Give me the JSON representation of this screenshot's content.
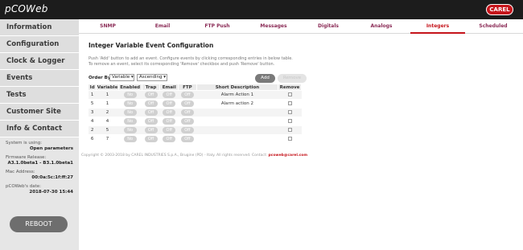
{
  "app": {
    "logo": "pCOWeb",
    "brand": "CAREL"
  },
  "sidebar": {
    "items": [
      {
        "label": "Information"
      },
      {
        "label": "Configuration"
      },
      {
        "label": "Clock & Logger"
      },
      {
        "label": "Events"
      },
      {
        "label": "Tests"
      },
      {
        "label": "Customer Site"
      },
      {
        "label": "Info & Contact"
      }
    ],
    "system_label": "System is using:",
    "system_value": "Open parameters",
    "firmware_label": "Firmware Release:",
    "firmware_value": "A3.1.0beta1 - B3.1.0beta1",
    "mac_label": "Mac Address:",
    "mac_value": "00:0a:5c:1f:ff:27",
    "date_label": "pCOWeb's date:",
    "date_value": "2018-07-30 15:44",
    "reboot_label": "REBOOT"
  },
  "tabs": [
    {
      "label": "SNMP"
    },
    {
      "label": "Email"
    },
    {
      "label": "FTP Push"
    },
    {
      "label": "Messages"
    },
    {
      "label": "Digitals"
    },
    {
      "label": "Analogs"
    },
    {
      "label": "Integers"
    },
    {
      "label": "Scheduled"
    }
  ],
  "page": {
    "title": "Integer Variable Event Configuration",
    "desc1": "Push 'Add' button to add an event. Configure events by clicking corresponding entries in below table.",
    "desc2": "To remove an event, select its corresponding 'Remove' checkbox and push 'Remove' button.",
    "order_label": "Order By",
    "order_by": "Variable",
    "order_dir": "Ascending",
    "add_label": "Add",
    "remove_label": "Remove"
  },
  "table": {
    "headers": [
      "Id",
      "Variable",
      "Enabled",
      "Trap",
      "Email",
      "FTP",
      "Short Description",
      "Remove"
    ],
    "rows": [
      {
        "id": "1",
        "variable": "1",
        "enabled": "No",
        "trap": "Off",
        "email": "Off",
        "ftp": "Off",
        "desc": "Alarm Action 1"
      },
      {
        "id": "5",
        "variable": "1",
        "enabled": "No",
        "trap": "Off",
        "email": "Off",
        "ftp": "Off",
        "desc": "Alarm action 2"
      },
      {
        "id": "3",
        "variable": "2",
        "enabled": "No",
        "trap": "Off",
        "email": "Off",
        "ftp": "Off",
        "desc": ""
      },
      {
        "id": "4",
        "variable": "4",
        "enabled": "No",
        "trap": "Off",
        "email": "Off",
        "ftp": "Off",
        "desc": ""
      },
      {
        "id": "2",
        "variable": "5",
        "enabled": "No",
        "trap": "Off",
        "email": "Off",
        "ftp": "Off",
        "desc": ""
      },
      {
        "id": "6",
        "variable": "7",
        "enabled": "No",
        "trap": "Off",
        "email": "Off",
        "ftp": "Off",
        "desc": ""
      }
    ]
  },
  "footer": {
    "text": "Copyright © 2003-2018 by CAREL INDUSTRIES S.p.A., Brugine (PD) - Italy. All rights reserved. Contact:",
    "email": "pcoweb@carel.com"
  },
  "colors": {
    "accent": "#c5141b",
    "tab_text": "#8a2a55",
    "sidebar_bg": "#dedede"
  }
}
